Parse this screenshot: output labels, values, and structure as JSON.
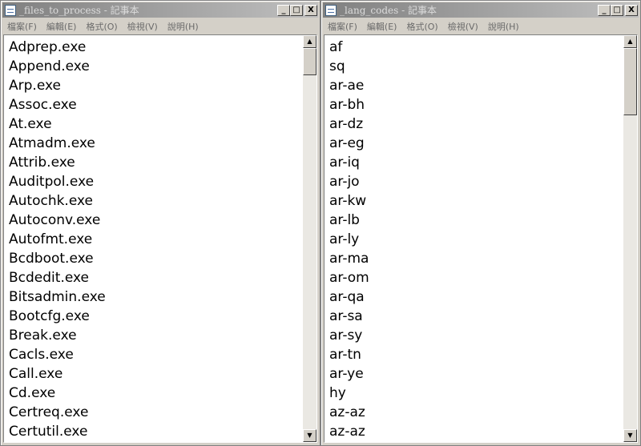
{
  "left_window": {
    "title": "_files_to_process - 記事本",
    "menu": [
      "檔案(F)",
      "編輯(E)",
      "格式(O)",
      "檢視(V)",
      "說明(H)"
    ],
    "lines": [
      "Adprep.exe",
      "Append.exe",
      "Arp.exe",
      "Assoc.exe",
      "At.exe",
      "Atmadm.exe",
      "Attrib.exe",
      "Auditpol.exe",
      "Autochk.exe",
      "Autoconv.exe",
      "Autofmt.exe",
      "Bcdboot.exe",
      "Bcdedit.exe",
      "Bitsadmin.exe",
      "Bootcfg.exe",
      "Break.exe",
      "Cacls.exe",
      "Call.exe",
      "Cd.exe",
      "Certreq.exe",
      "Certutil.exe"
    ]
  },
  "right_window": {
    "title": "_lang_codes - 記事本",
    "menu": [
      "檔案(F)",
      "編輯(E)",
      "格式(O)",
      "檢視(V)",
      "說明(H)"
    ],
    "lines": [
      "af",
      "sq",
      "ar-ae",
      "ar-bh",
      "ar-dz",
      "ar-eg",
      "ar-iq",
      "ar-jo",
      "ar-kw",
      "ar-lb",
      "ar-ly",
      "ar-ma",
      "ar-om",
      "ar-qa",
      "ar-sa",
      "ar-sy",
      "ar-tn",
      "ar-ye",
      "hy",
      "az-az",
      "az-az"
    ]
  },
  "title_buttons": {
    "minimize": "_",
    "maximize": "□",
    "close": "X"
  },
  "icons": {
    "notepad": "notepad-icon",
    "scroll_up": "▲",
    "scroll_down": "▼"
  }
}
